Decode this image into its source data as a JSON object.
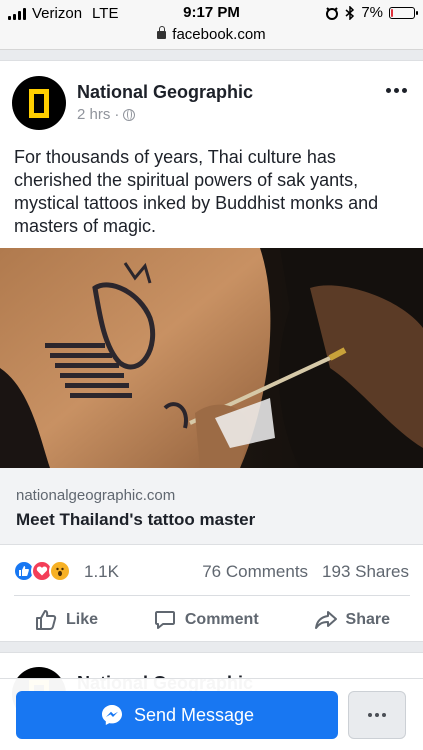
{
  "status_bar": {
    "carrier": "Verizon",
    "network": "LTE",
    "time": "9:17 PM",
    "battery_percent": "7%",
    "battery_level": 0.07,
    "battery_color": "#e0313b"
  },
  "url_bar": {
    "url": "facebook.com",
    "icon": "lock-icon"
  },
  "post": {
    "page_name": "National Geographic",
    "timestamp": "2 hrs",
    "separator": "·",
    "privacy_icon": "globe-icon",
    "text": "For thousands of years, Thai culture has cherished the spiritual powers of sak yants, mystical tattoos inked by Buddhist monks and masters of magic.",
    "link": {
      "domain": "nationalgeographic.com",
      "title": "Meet Thailand's tattoo master"
    },
    "reactions": {
      "icons": [
        "like-icon",
        "love-icon",
        "wow-icon"
      ],
      "count": "1.1K"
    },
    "comments": "76 Comments",
    "shares": "193 Shares",
    "actions": {
      "like": "Like",
      "comment": "Comment",
      "share": "Share"
    }
  },
  "next_post": {
    "page_name": "National Geographic"
  },
  "bottom_bar": {
    "send_label": "Send Message",
    "accent": "#1877f2"
  },
  "brand_color": "#ffce00"
}
